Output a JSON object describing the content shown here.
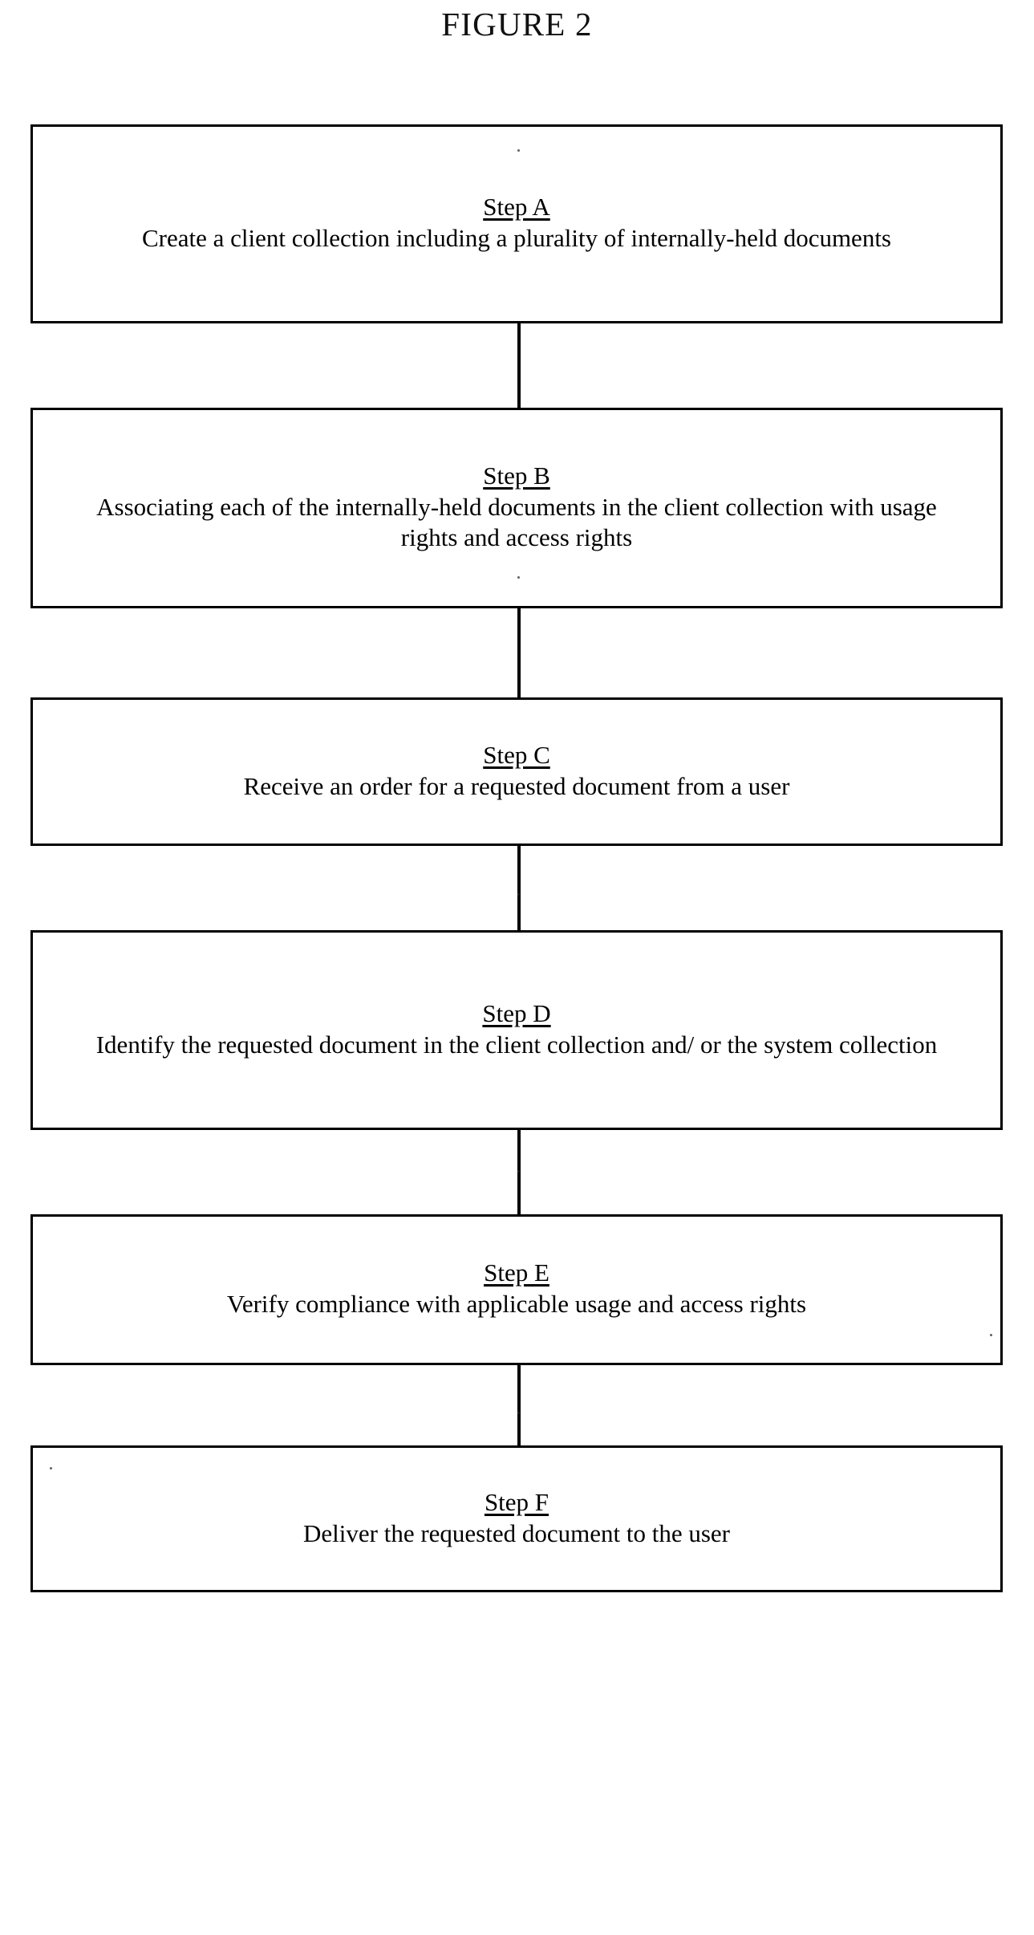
{
  "figure": {
    "title": "FIGURE 2",
    "type": "process-flowchart",
    "orientation": "vertical-top-to-bottom"
  },
  "steps": [
    {
      "id": "a",
      "label": "Step A",
      "text": "Create a client collection including a plurality of internally-held documents"
    },
    {
      "id": "b",
      "label": "Step B",
      "text": "Associating each of the internally-held documents in the client collection with usage rights and access rights"
    },
    {
      "id": "c",
      "label": "Step C",
      "text": "Receive an order for a requested document from a user"
    },
    {
      "id": "d",
      "label": "Step D",
      "text": "Identify the requested document in the client collection and/ or the system collection"
    },
    {
      "id": "e",
      "label": "Step E",
      "text": "Verify compliance with applicable usage and access rights"
    },
    {
      "id": "f",
      "label": "Step F",
      "text": "Deliver the requested document to the user"
    }
  ],
  "connectors": [
    {
      "from": "Step A",
      "to": "Step B"
    },
    {
      "from": "Step B",
      "to": "Step C"
    },
    {
      "from": "Step C",
      "to": "Step D"
    },
    {
      "from": "Step D",
      "to": "Step E"
    },
    {
      "from": "Step E",
      "to": "Step F"
    }
  ],
  "colors": {
    "ink": "#000000",
    "page": "#ffffff"
  }
}
